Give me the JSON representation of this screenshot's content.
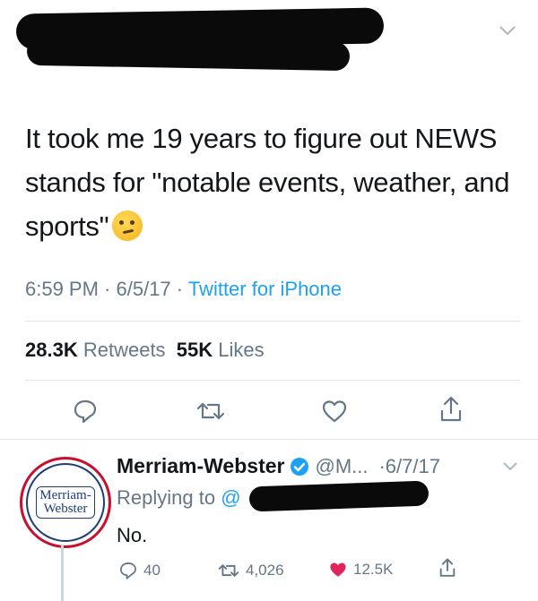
{
  "tweet": {
    "text": "It took me 19 years to figure out NEWS stands for \"notable events, weather, and sports\"",
    "emoji": "thinking-face",
    "time": "6:59 PM",
    "date": "6/5/17",
    "source": "Twitter for iPhone",
    "retweets_count": "28.3K",
    "retweets_label": "Retweets",
    "likes_count": "55K",
    "likes_label": "Likes"
  },
  "reply": {
    "avatar_line1": "Merriam-",
    "avatar_line2": "Webster",
    "name": "Merriam-Webster",
    "handle": "@M...",
    "date": "·6/7/17",
    "replying_prefix": "Replying to",
    "replying_at": "@",
    "text": "No.",
    "reply_count": "40",
    "retweet_count": "4,026",
    "like_count": "12.5K"
  },
  "colors": {
    "link": "#1da1f2",
    "muted": "#657786",
    "like": "#e0245e",
    "verified": "#1da1f2"
  }
}
